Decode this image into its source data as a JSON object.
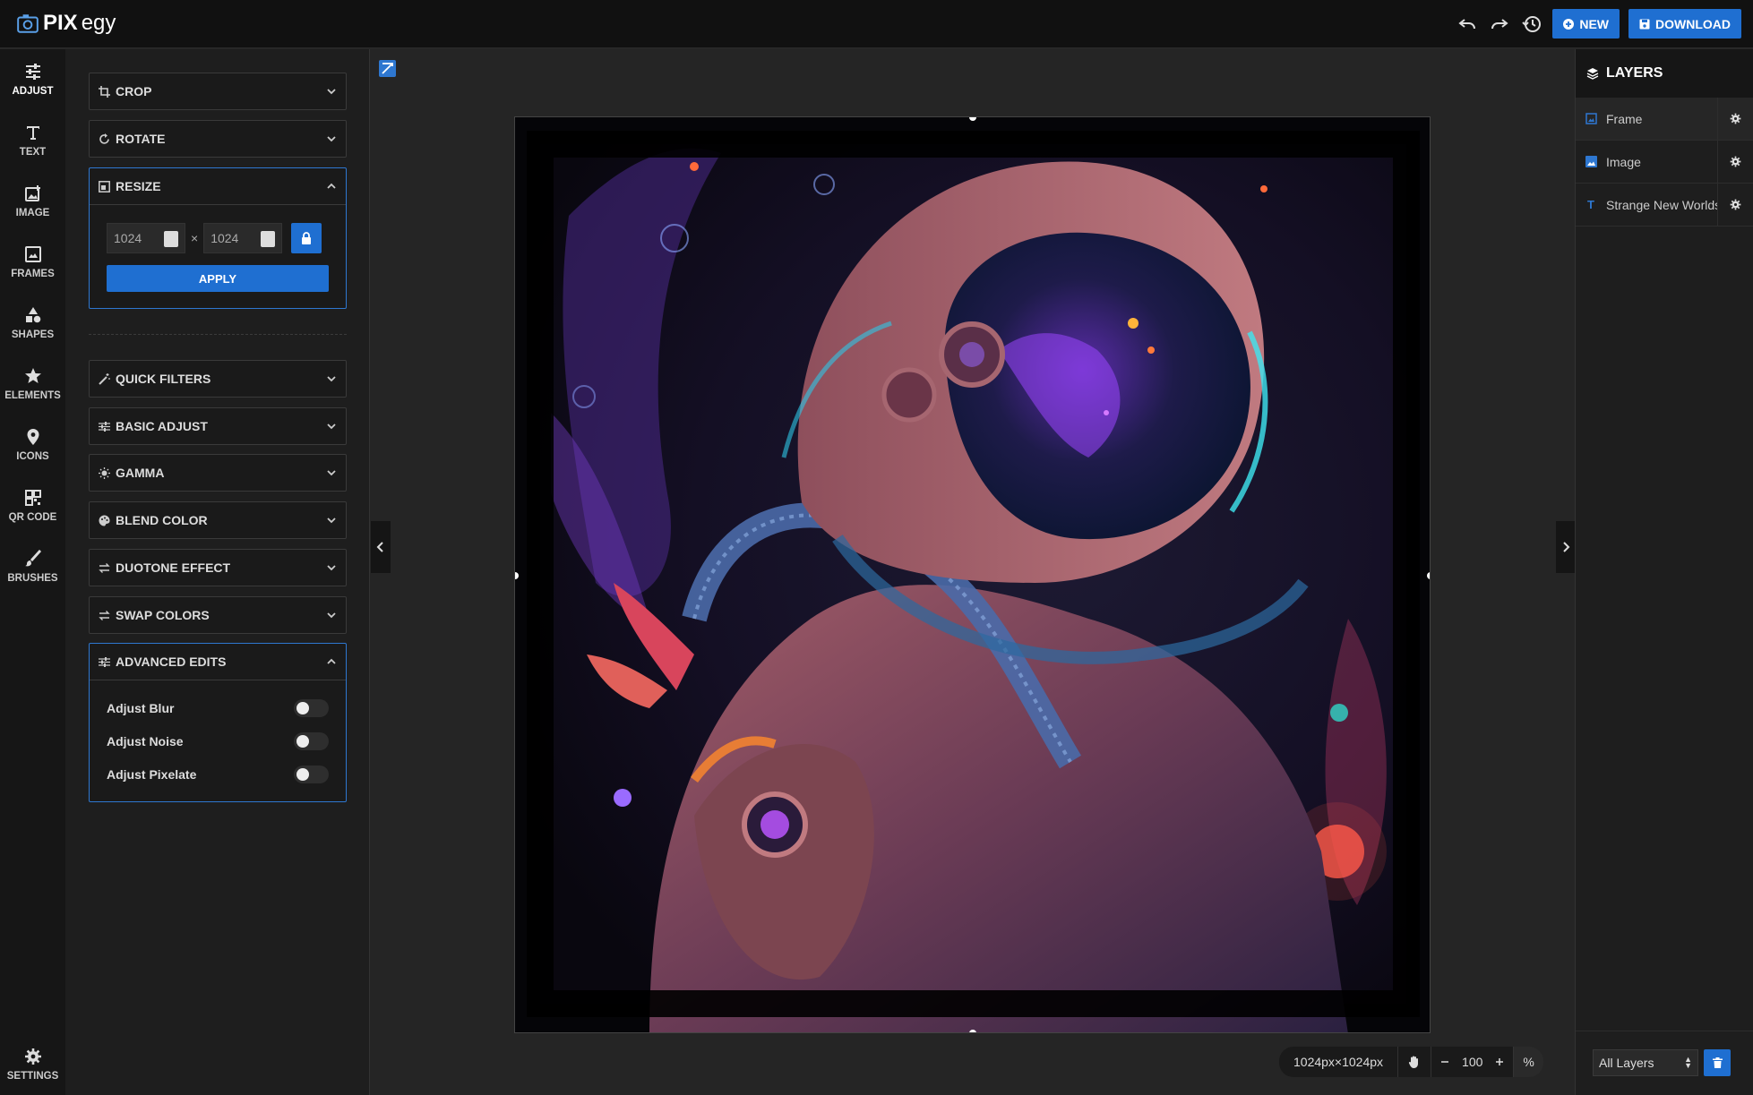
{
  "app": {
    "logo_text": "PIXegy",
    "logo_prefix": "PIX",
    "logo_suffix": "egy"
  },
  "top": {
    "new_label": "NEW",
    "download_label": "DOWNLOAD"
  },
  "nav": {
    "adjust": "ADJUST",
    "text": "TEXT",
    "image": "IMAGE",
    "frames": "FRAMES",
    "shapes": "SHAPES",
    "elements": "ELEMENTS",
    "icons": "ICONS",
    "qr_code": "QR CODE",
    "brushes": "BRUSHES",
    "settings": "SETTINGS"
  },
  "panel": {
    "crop": "CROP",
    "rotate": "ROTATE",
    "resize": "RESIZE",
    "resize_width": "1024",
    "resize_height": "1024",
    "times": "×",
    "apply": "APPLY",
    "quick_filters": "QUICK FILTERS",
    "basic_adjust": "BASIC ADJUST",
    "gamma": "GAMMA",
    "blend_color": "BLEND COLOR",
    "duotone": "DUOTONE EFFECT",
    "swap_colors": "SWAP COLORS",
    "advanced_edits": "ADVANCED EDITS",
    "adjust_blur": "Adjust Blur",
    "adjust_noise": "Adjust Noise",
    "adjust_pixelate": "Adjust Pixelate"
  },
  "canvas": {
    "size_label": "1024px×1024px",
    "zoom": "100",
    "zoom_unit": "%"
  },
  "layers": {
    "title": "LAYERS",
    "items": [
      {
        "name": "Frame",
        "icon": "frame-icon"
      },
      {
        "name": "Image",
        "icon": "image-icon"
      },
      {
        "name": "Strange New Worlds",
        "icon": "text-icon"
      }
    ],
    "filter": "All Layers"
  },
  "colors": {
    "accent": "#1f6fd1",
    "bg": "#252525",
    "topbar": "#111111"
  }
}
